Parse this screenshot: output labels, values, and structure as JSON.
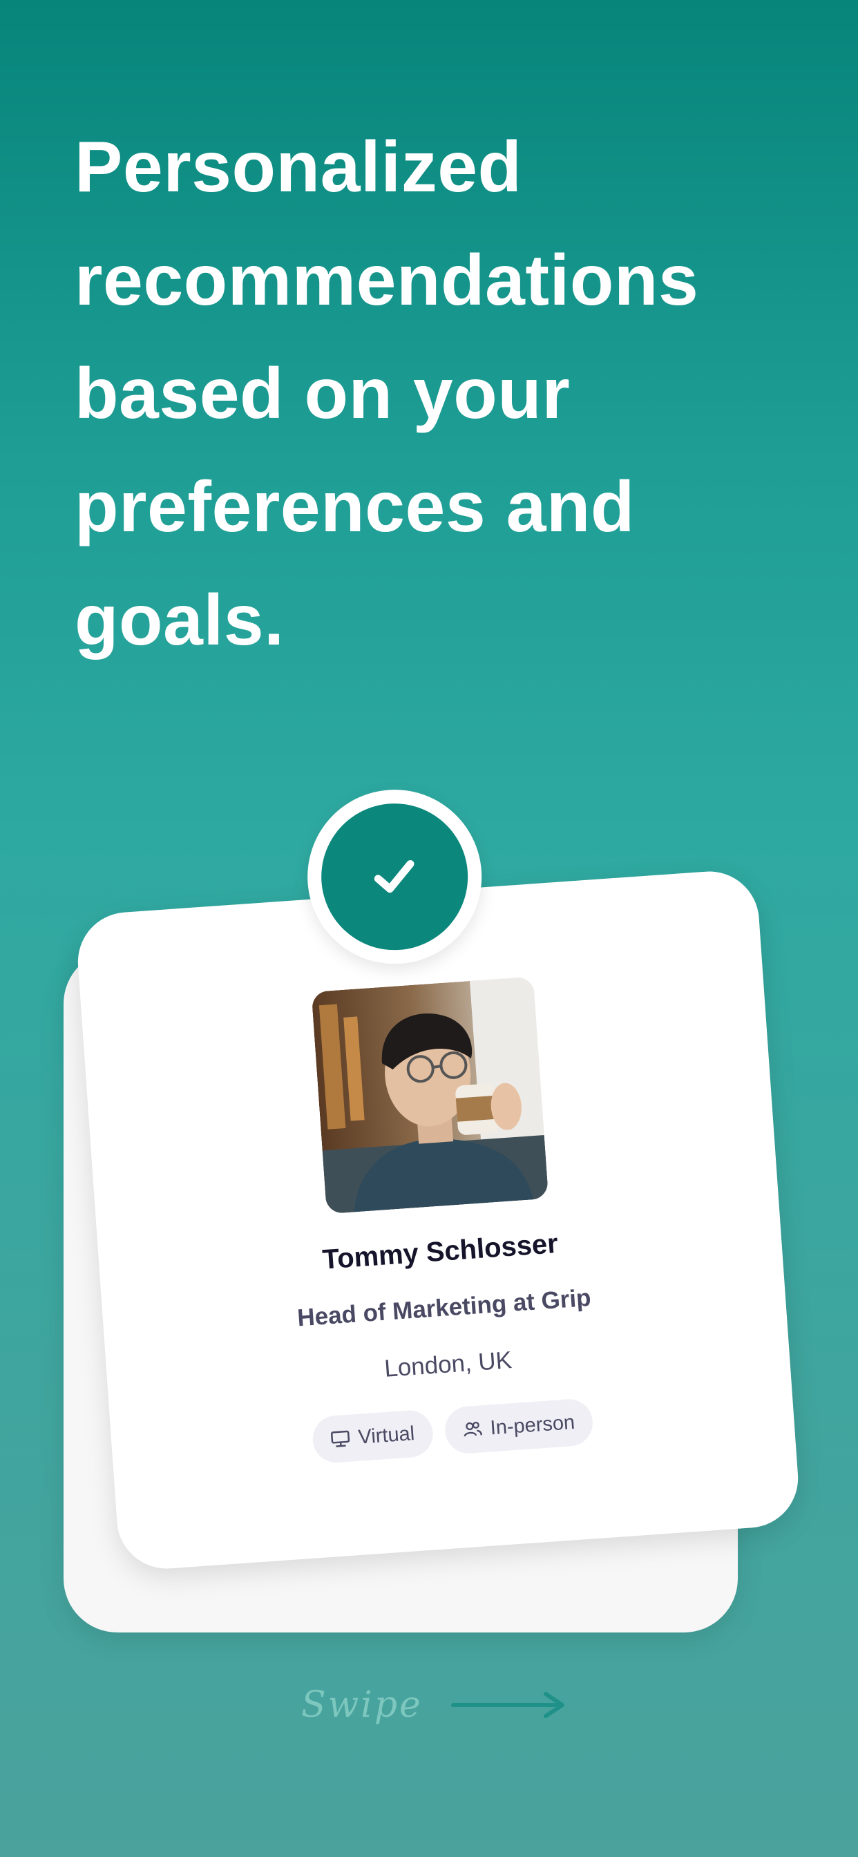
{
  "headline": "Personalized recommendations based on your preferences and goals.",
  "card": {
    "badge_icon": "checkmark-icon",
    "photo": "profile-photo",
    "name": "Tommy Schlosser",
    "title": "Head of Marketing at Grip",
    "location": "London, UK",
    "tags": [
      {
        "label": "Virtual",
        "icon": "monitor-icon"
      },
      {
        "label": "In-person",
        "icon": "people-icon"
      }
    ]
  },
  "swipe": {
    "label": "Swipe",
    "icon": "arrow-right-icon"
  },
  "colors": {
    "accent": "#0b877c",
    "background_top": "#07857b",
    "background_bottom": "#4ba29d",
    "text_dark": "#15142a",
    "text_muted": "#4a4963",
    "tag_bg": "#efeff5"
  }
}
